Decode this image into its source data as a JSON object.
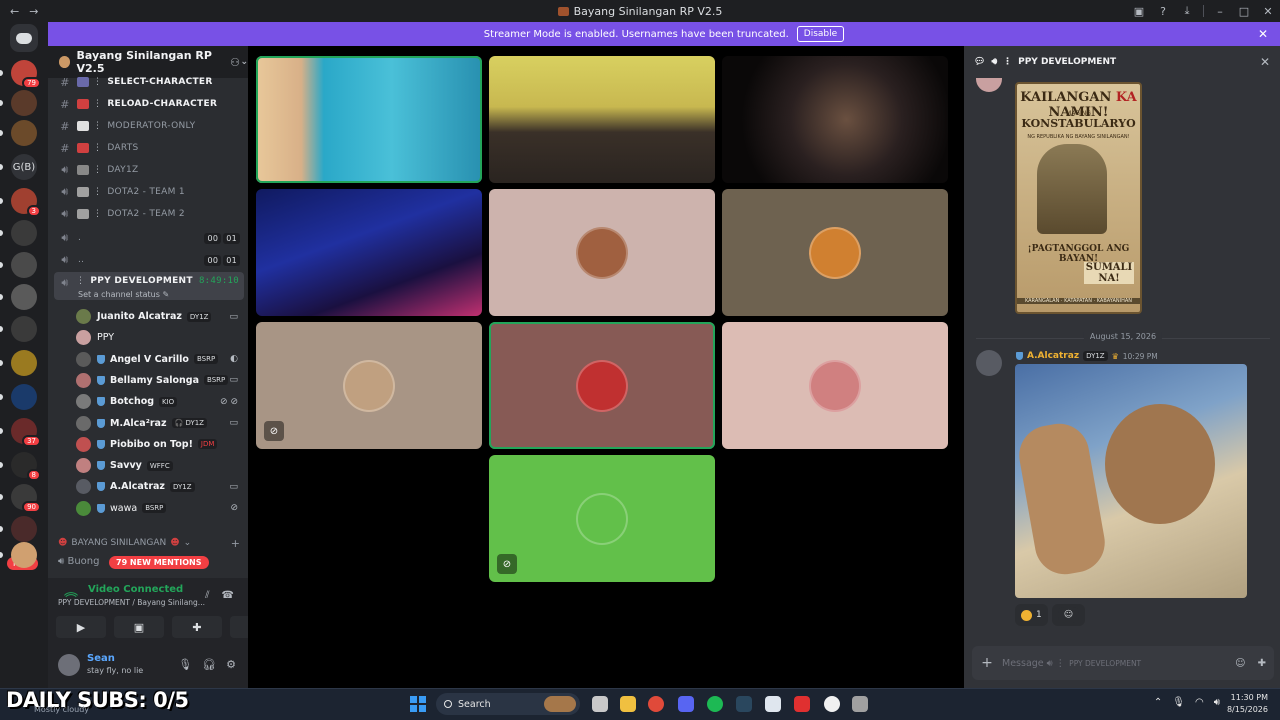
{
  "window": {
    "title": "Bayang Sinilangan RP V2.5"
  },
  "banner": {
    "text": "Streamer Mode is enabled. Usernames have been truncated.",
    "disable_label": "Disable"
  },
  "rail": {
    "servers": [
      {
        "badge": "79",
        "color": "#c0443a"
      },
      {
        "badge": "",
        "color": "#5a3a2a"
      },
      {
        "badge": "",
        "color": "#6b4a2a"
      },
      {
        "label": "G(B)"
      },
      {
        "badge": "3",
        "color": "#a04030"
      },
      {
        "badge": "",
        "color": "#3a3a3a"
      },
      {
        "badge": "",
        "color": "#4a4a4a"
      },
      {
        "badge": "",
        "color": "#5a5a5a"
      },
      {
        "badge": "",
        "color": "#3a3a3a"
      },
      {
        "badge": "",
        "color": "#9a7a20"
      },
      {
        "badge": "",
        "color": "#1a3a6a"
      },
      {
        "badge": "37",
        "color": "#6a2a2a"
      },
      {
        "badge": "8",
        "color": "#2a2a2a"
      },
      {
        "badge": "90",
        "color": "#3a3a3a"
      },
      {
        "badge": "",
        "color": "#4a2a2a"
      },
      {
        "badge": "",
        "color": "#d0a070"
      }
    ],
    "new_pill": "NEW"
  },
  "sidebar": {
    "guild_name": "Bayang Sinilangan RP V2.5",
    "channels": [
      {
        "type": "text",
        "name": "select-character",
        "emoji_color": "#6a6aaa",
        "bold": true
      },
      {
        "type": "text",
        "name": "reload-character",
        "emoji_color": "#d04040",
        "bold": true
      },
      {
        "type": "text",
        "name": "moderator-only",
        "emoji_color": "#e0e0e0",
        "bold": false
      },
      {
        "type": "text",
        "name": "darts",
        "emoji_color": "#d04040",
        "bold": false
      },
      {
        "type": "voice",
        "name": "day1z",
        "emoji_color": "#888888",
        "bold": false
      },
      {
        "type": "voice",
        "name": "dota2 - team 1",
        "emoji_color": "#a0a0a0",
        "bold": false
      },
      {
        "type": "voice",
        "name": "dota2 - team 2",
        "emoji_color": "#a0a0a0",
        "bold": false
      },
      {
        "type": "voice",
        "name": ".",
        "timer": [
          "00",
          "01"
        ]
      },
      {
        "type": "voice",
        "name": "..",
        "timer": [
          "00",
          "01"
        ]
      }
    ],
    "active_channel": {
      "name": "ppy development",
      "timer": "8:49:10",
      "status_placeholder": "Set a channel status"
    },
    "members": [
      {
        "name": "Juanito Alcatraz",
        "tag": "DY1Z",
        "avatar": "#6a7a4a",
        "shield": false,
        "icons": "▭"
      },
      {
        "name": "PPY",
        "tag": "",
        "avatar": "#c9a0a0",
        "shield": false,
        "plain": true,
        "icons": ""
      },
      {
        "name": "Angel V Carillo",
        "tag": "BSRP",
        "avatar": "#5a5a5a",
        "shield": true,
        "icons": "◐"
      },
      {
        "name": "Bellamy Salonga",
        "tag": "BSRP",
        "avatar": "#b07070",
        "shield": true,
        "icons": "▭"
      },
      {
        "name": "Botchog",
        "tag": "KIO",
        "avatar": "#7a7a7a",
        "shield": true,
        "icons": "⊘ ⊘"
      },
      {
        "name": "M.Alca²raz",
        "tag": "🎧 DY1Z",
        "avatar": "#6a6a6a",
        "shield": true,
        "icons": "▭"
      },
      {
        "name": "Piobibo on Top!",
        "tag": "JDM",
        "avatar": "#c05050",
        "shield": true,
        "icons": "",
        "tag_red": true
      },
      {
        "name": "Savvy",
        "tag": "WFFC",
        "avatar": "#c08080",
        "shield": true,
        "icons": ""
      },
      {
        "name": "A.Alcatraz",
        "tag": "DY1Z",
        "avatar": "#585b63",
        "shield": true,
        "icons": "▭"
      },
      {
        "name": "wawa",
        "tag": "BSRP",
        "avatar": "#4a8a3a",
        "shield": true,
        "plain": true,
        "icons": "⊘"
      }
    ],
    "category": "BAYANG SINILANGAN",
    "buong_label": "Buong",
    "mentions_pill": "79 NEW MENTIONS"
  },
  "voice_panel": {
    "status": "Video Connected",
    "location": "PPY DEVELOPMENT / Bayang Sinilang..."
  },
  "user_panel": {
    "name": "Sean",
    "status": "stay fly, no lie"
  },
  "stage": {
    "tiles": [
      {
        "kind": "video",
        "speaking": true,
        "bg": "linear-gradient(90deg,#e8c89a 0%,#d8b088 20%,#2aa8c8 30%,#4ac0d8 60%,#2890b0 100%)"
      },
      {
        "kind": "video",
        "speaking": false,
        "bg": "linear-gradient(180deg,#d8d060 0%,#c8b850 40%,#3a3028 60%,#2a2420 100%)"
      },
      {
        "kind": "video",
        "speaking": false,
        "bg": "radial-gradient(circle at 55% 50%,#6a5040 0%,#2a2020 40%,#0a0808 75%)"
      },
      {
        "kind": "video",
        "speaking": false,
        "bg": "linear-gradient(160deg,#101a60 0%,#2030a0 40%,#1a1040 70%,#c03070 100%)"
      },
      {
        "kind": "avatar",
        "speaking": false,
        "bg": "#cdb3ad",
        "avatar": "#a06040"
      },
      {
        "kind": "avatar",
        "speaking": false,
        "bg": "#6e6250",
        "avatar": "#d08030"
      },
      {
        "kind": "avatar",
        "speaking": false,
        "bg": "#a89585",
        "avatar": "#c0a080",
        "muted": true
      },
      {
        "kind": "avatar",
        "speaking": true,
        "bg": "#875a55",
        "avatar": "#c03030"
      },
      {
        "kind": "avatar",
        "speaking": false,
        "bg": "#dcbcb4",
        "avatar": "#d08080"
      },
      {
        "kind": "avatar",
        "speaking": false,
        "bg": "#62c04a",
        "avatar": "#62c04a",
        "muted": true
      }
    ]
  },
  "panel": {
    "channel": "PPY DEVELOPMENT",
    "poster": {
      "l1a": "KAILANGAN ",
      "l1b": "KA",
      "l1c": " NAMIN!",
      "l2": "MAGING",
      "l3": "KONSTABULARYO",
      "l4": "NG REPUBLIKA NG BAYANG SINILANGAN!",
      "l5": "¡PAGTANGGOL ANG BAYAN!",
      "l6": "SUMALI NA!",
      "l7": "KARANGALAN · KATAPATAN · KABAYANIHAN"
    },
    "date_divider": "August 15, 2026",
    "message": {
      "author": "A.Alcatraz",
      "tag": "DY1Z",
      "time": "10:29 PM"
    },
    "reaction_count": "1",
    "composer_placeholder": "Message",
    "composer_channel": "PPY DEVELOPMENT"
  },
  "taskbar": {
    "overlay": "DAILY SUBS: 0/5",
    "overlay_sub": "Mostly cloudy",
    "search": "Search",
    "time": "11:30 PM",
    "date": "8/15/2026"
  }
}
